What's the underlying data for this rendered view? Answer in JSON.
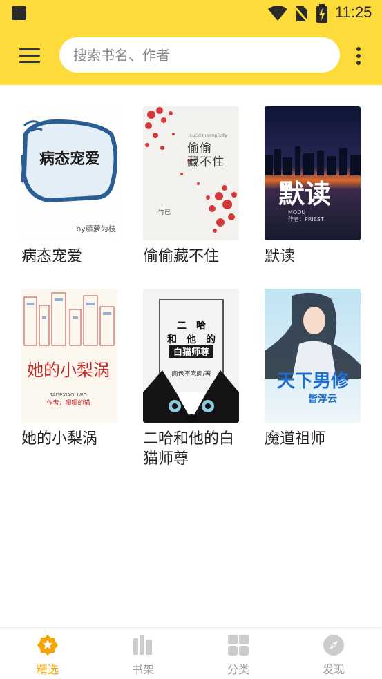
{
  "status_bar": {
    "time": "11:25"
  },
  "search": {
    "placeholder": "搜索书名、作者",
    "value": ""
  },
  "books": [
    {
      "title": "病态宠爱",
      "cover_text": "病态宠爱",
      "cover_author": "by藤萝为枝"
    },
    {
      "title": "偷偷藏不住",
      "cover_text": "偷偷藏不住",
      "cover_author": "竹已",
      "cover_en": "Lucid in simplicity"
    },
    {
      "title": "默读",
      "cover_text": "默读",
      "cover_pinyin": "MODU",
      "cover_author": "作者：PRIEST"
    },
    {
      "title": "她的小梨涡",
      "cover_text": "她的小梨涡",
      "cover_pinyin": "TADEXIAOLIWO",
      "cover_author": "作者：唧唧的猫"
    },
    {
      "title": "二哈和他的白猫师尊",
      "cover_lines": [
        "二　哈",
        "和　他　的",
        "白猫师尊"
      ],
      "cover_author": "肉包不吃肉/著"
    },
    {
      "title": "魔道祖师",
      "cover_text": "天下男修",
      "cover_sub": "皆浮云"
    }
  ],
  "bottom_nav": [
    {
      "label": "精选",
      "icon": "star-badge-icon",
      "active": true
    },
    {
      "label": "书架",
      "icon": "bookshelf-icon",
      "active": false
    },
    {
      "label": "分类",
      "icon": "category-grid-icon",
      "active": false
    },
    {
      "label": "发现",
      "icon": "compass-icon",
      "active": false
    }
  ],
  "colors": {
    "accent": "#fddb3a",
    "active_tab": "#f5a400",
    "inactive_tab": "#cccccc"
  }
}
